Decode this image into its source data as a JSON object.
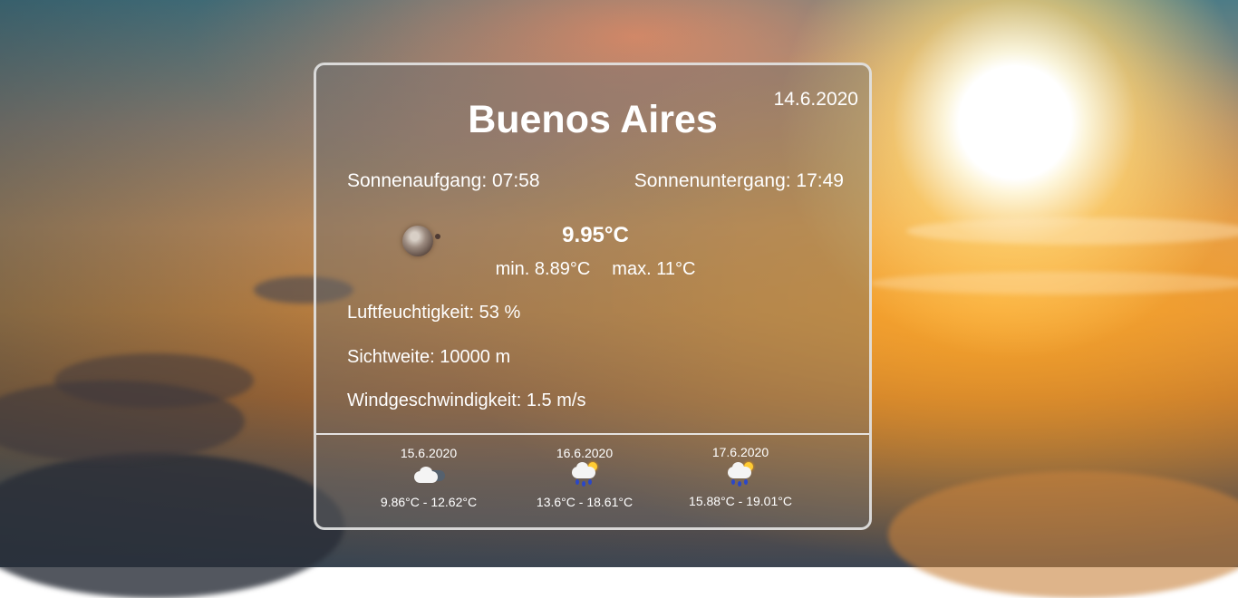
{
  "weather": {
    "date": "14.6.2020",
    "city": "Buenos Aires",
    "sunrise": "Sonnenaufgang: 07:58",
    "sunset": "Sonnenuntergang: 17:49",
    "icon": "overcast-clouds-icon",
    "temperature": "9.95°C",
    "min": "min. 8.89°C",
    "max": "max. 11°C",
    "humidity": "Luftfeuchtigkeit: 53 %",
    "visibility": "Sichtweite: 10000 m",
    "wind": "Windgeschwindigkeit: 1.5 m/s"
  },
  "forecast": [
    {
      "date": "15.6.2020",
      "icon": "partly-cloudy-night-icon",
      "range": "9.86°C - 12.62°C"
    },
    {
      "date": "16.6.2020",
      "icon": "rain-sun-icon",
      "range": "13.6°C - 18.61°C"
    },
    {
      "date": "17.6.2020",
      "icon": "rain-sun-icon",
      "range": "15.88°C - 19.01°C"
    }
  ]
}
